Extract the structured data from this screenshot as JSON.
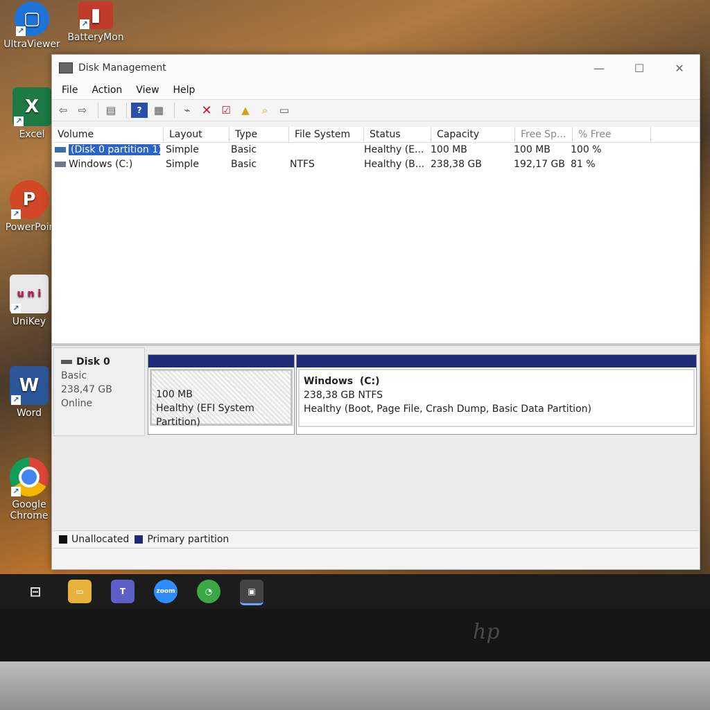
{
  "desktop": {
    "icons": [
      "UltraViewer",
      "BatteryMon",
      "Excel",
      "PowerPoir",
      "UniKey",
      "Word",
      "Google Chrome"
    ]
  },
  "window": {
    "title": "Disk Management",
    "menu": [
      "File",
      "Action",
      "View",
      "Help"
    ],
    "columns": [
      "Volume",
      "Layout",
      "Type",
      "File System",
      "Status",
      "Capacity",
      "Free Sp...",
      "% Free"
    ],
    "rows": [
      [
        "(Disk 0 partition 1)",
        "Simple",
        "Basic",
        "",
        "Healthy (E...",
        "100 MB",
        "100 MB",
        "100 %"
      ],
      [
        "Windows (C:)",
        "Simple",
        "Basic",
        "NTFS",
        "Healthy (B...",
        "238,38 GB",
        "192,17 GB",
        "81 %"
      ]
    ],
    "disk": {
      "name": "Disk 0",
      "type": "Basic",
      "size": "238,47 GB",
      "state": "Online"
    },
    "partitions": [
      {
        "title": "",
        "size": "100 MB",
        "status": "Healthy (EFI System Partition)"
      },
      {
        "title": "Windows  (C:)",
        "size": "238,38 GB NTFS",
        "status": "Healthy (Boot, Page File, Crash Dump, Basic Data Partition)"
      }
    ],
    "legend": [
      "Unallocated",
      "Primary partition"
    ]
  },
  "colors": {
    "primary_partition": "#1f2a78",
    "unallocated": "#111111",
    "selection": "#2b64c8"
  },
  "taskbar": {
    "zoom_label": "zoom",
    "apps": [
      "task-view-icon",
      "file-explorer-icon",
      "teams-icon",
      "zoom-icon",
      "coc-coc-icon",
      "disk-management-icon"
    ]
  },
  "bezel_logo": "hp"
}
